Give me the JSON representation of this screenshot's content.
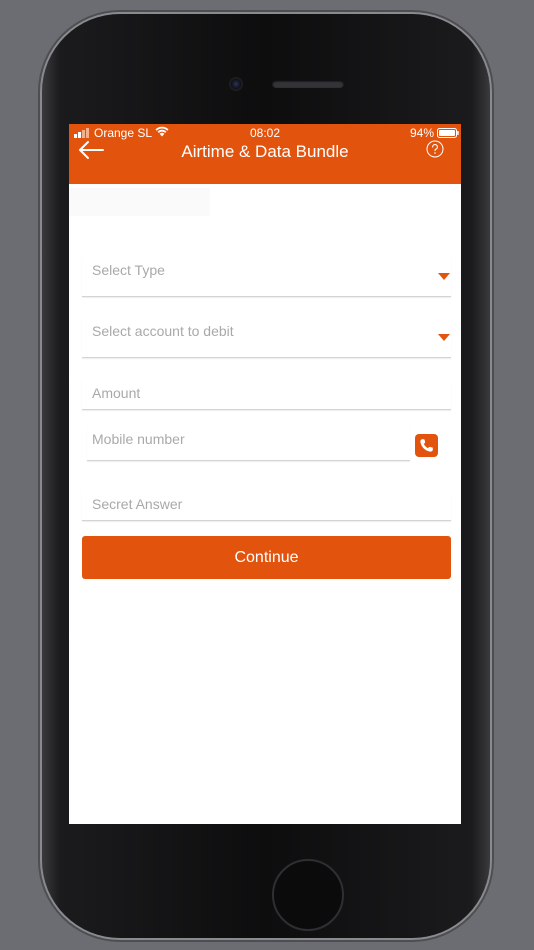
{
  "status_bar": {
    "carrier": "Orange SL",
    "time": "08:02",
    "battery": "94%"
  },
  "header": {
    "title": "Airtime & Data Bundle",
    "back_icon": "back-arrow-icon",
    "help_icon": "help-circle-icon"
  },
  "form": {
    "type_placeholder": "Select Type",
    "account_placeholder": "Select account to debit",
    "amount_placeholder": "Amount",
    "mobile_placeholder": "Mobile number",
    "secret_placeholder": "Secret Answer",
    "contact_icon": "phone-icon",
    "continue_label": "Continue"
  },
  "colors": {
    "accent": "#e2540e",
    "background": "#6b6d72"
  }
}
